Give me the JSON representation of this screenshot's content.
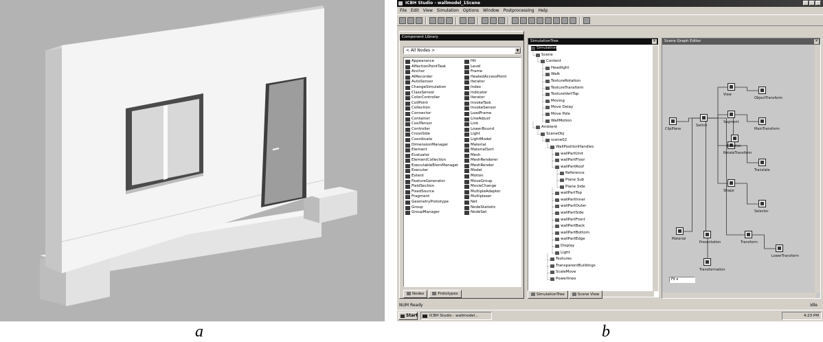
{
  "captions": {
    "a": "a",
    "b": "b"
  },
  "ide": {
    "title": "ICBH Studio - wallmodel_1Scene",
    "menu": [
      "File",
      "Edit",
      "View",
      "Simulation",
      "Options",
      "Window",
      "Postprocessing",
      "Help"
    ],
    "library": {
      "title": "Component Library",
      "filter": "< All Nodes >",
      "col1": [
        "Appearance",
        "AffectionPointTask",
        "Anchor",
        "AtRecorder",
        "AutoSensor",
        "ChangeSimulation",
        "ClassSensor",
        "ColorController",
        "CoilPoint",
        "Collection",
        "Connector",
        "Container",
        "CoolTensor",
        "Controller",
        "CrossSide",
        "Coordinate",
        "DimensionManager",
        "Element",
        "Evaluator",
        "ElementCollection",
        "ExecutableElemManager",
        "Executer",
        "Extent",
        "FeatureGenerator",
        "FieldSection",
        "FixedSource",
        "Fragment",
        "GeometryPrototype",
        "Group",
        "GroupManager"
      ],
      "col2": [
        "Hit",
        "Level",
        "Frame",
        "HeatedAccessPoint",
        "Iterator",
        "Index",
        "Indicator",
        "Iterator",
        "InvokeTask",
        "InvokeSensor",
        "LoadFrame",
        "LineAdjust",
        "Link",
        "LowerBound",
        "Light",
        "LightModel",
        "Material",
        "MaterialSort",
        "Mesh",
        "MeshRenderer",
        "MeshRender",
        "Model",
        "Motion",
        "MoveGroup",
        "MovieChange",
        "MultipleAdapter",
        "Multiplexer",
        "Net",
        "NodeStatistic",
        "NodeSet"
      ],
      "tabs": [
        "Nodes",
        "Prototypes"
      ]
    },
    "tree": {
      "title": "SimulationTree",
      "nodes": [
        "Simulation",
        "Scene",
        "Content",
        "Headlight",
        "Walk",
        "TextureRotation",
        "TextureTransform",
        "TextureVertTop",
        "Moving",
        "Move Delay",
        "Move Pole",
        "WallMotion",
        "Ambient",
        "SceneObj",
        "scene02",
        "WallPositionHandles",
        "wallPartUnit",
        "wallPartFloor",
        "wallPartRoof",
        "Reference",
        "Plane Sub",
        "Plane Side",
        "wallPartTop",
        "wallPartInner",
        "wallPartOuter",
        "wallPartSide",
        "wallPartFront",
        "wallPartBack",
        "wallPartBottom",
        "wallPartEdge",
        "Display",
        "Light",
        "Textures",
        "TransparentBuildings",
        "ScaleMove",
        "Powerlines"
      ],
      "tabs": [
        "SimulationTree",
        "Scene View"
      ]
    },
    "diagram": {
      "title": "Scene Graph Editor",
      "labels": [
        "View",
        "ObjectTransform",
        "Segment",
        "MainTransform",
        "RotateTransform",
        "Translate",
        "ClipPlane",
        "Switch",
        "Shape",
        "Selector",
        "Material",
        "Presentation",
        "Transform",
        "LowerTransform",
        "Rotation",
        "Transformation"
      ],
      "zoom": "Fit"
    },
    "status": {
      "left": "NUM Ready",
      "right": "Idle"
    },
    "taskbar": {
      "start": "Start",
      "task": "ICBH Studio - wallmodel...",
      "clock": "4:23 PM"
    }
  }
}
